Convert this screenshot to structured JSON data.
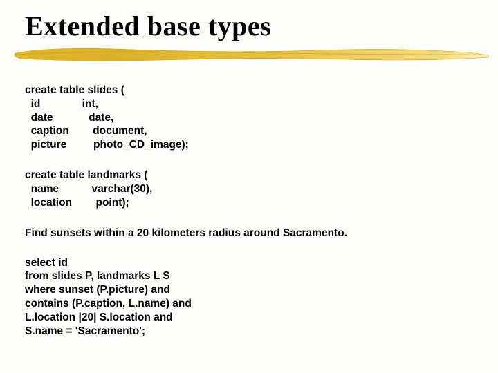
{
  "title": "Extended base types",
  "code1": "create table slides (\n  id              int,\n  date            date,\n  caption        document,\n  picture         photo_CD_image);",
  "code2": "create table landmarks (\n  name           varchar(30),\n  location        point);",
  "sentence": "Find sunsets within a 20 kilometers radius around Sacramento.",
  "query": "select id\nfrom slides P, landmarks L S\nwhere sunset (P.picture) and\ncontains (P.caption, L.name) and\nL.location |20| S.location and\nS.name = 'Sacramento';"
}
